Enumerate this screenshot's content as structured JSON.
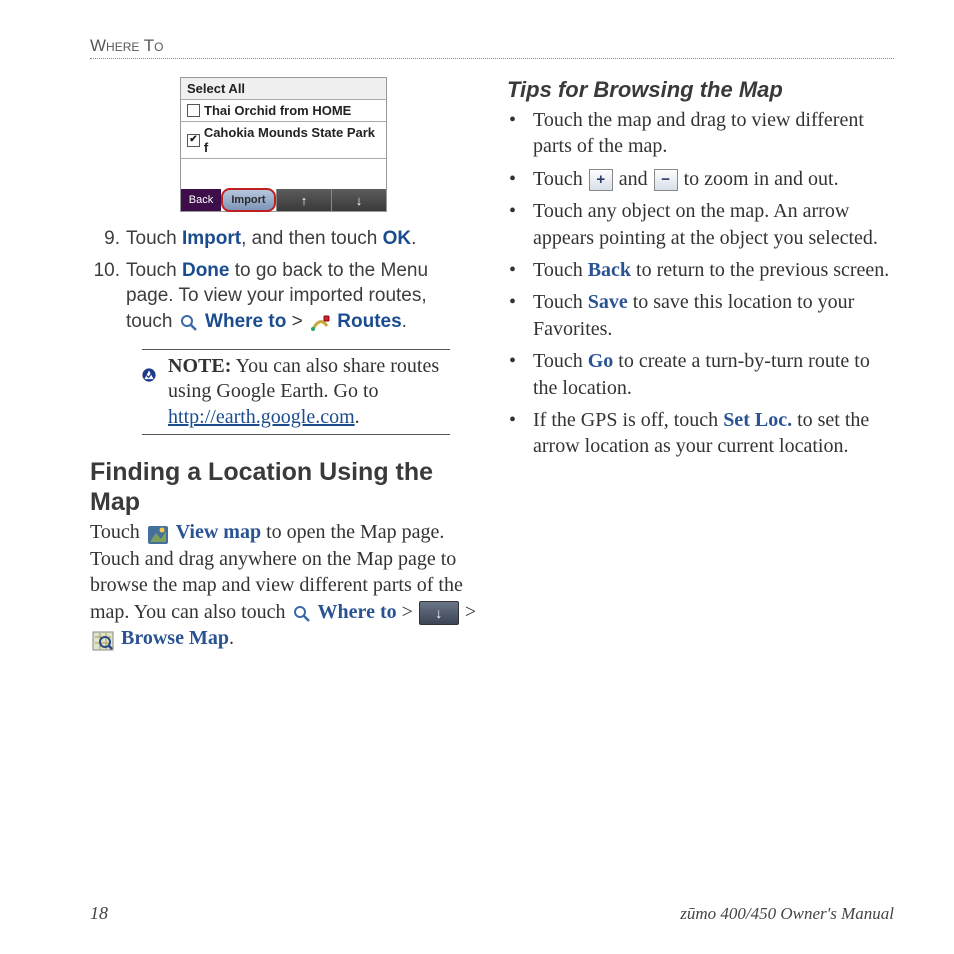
{
  "header": "Where To",
  "screenshot": {
    "select_all": "Select All",
    "row1": "Thai Orchid from HOME",
    "row2": "Cahokia Mounds State Park f",
    "back": "Back",
    "import": "Import"
  },
  "steps": {
    "s9_num": "9.",
    "s9_a": "Touch ",
    "s9_b": "Import",
    "s9_c": ", and then touch ",
    "s9_d": "OK",
    "s9_e": ".",
    "s10_num": "10.",
    "s10_a": "Touch ",
    "s10_b": "Done",
    "s10_c": " to go back to the Menu page. To view your imported routes, touch ",
    "s10_d": "Where to",
    "s10_e": " > ",
    "s10_f": "Routes",
    "s10_g": "."
  },
  "note": {
    "label": "NOTE:",
    "text": " You can also share routes using Google Earth. Go to ",
    "link": "http://earth.google.com",
    "dot": "."
  },
  "section": "Finding a Location Using the Map",
  "finding": {
    "a": "Touch ",
    "b": "View map",
    "c": " to open the Map page. Touch and drag anywhere on the Map page to browse the map and view different parts of the map. You can also touch ",
    "d": "Where to",
    "e": " > ",
    "f": " > ",
    "g": "Browse Map",
    "h": "."
  },
  "subsection": "Tips for Browsing the Map",
  "tips": {
    "t1": "Touch the map and drag to view different parts of the map.",
    "t2a": "Touch ",
    "t2b": " and ",
    "t2c": " to zoom in and out.",
    "t3": "Touch any object on the map. An arrow appears pointing at the object you selected.",
    "t4a": "Touch ",
    "t4b": "Back",
    "t4c": " to return to the previous screen.",
    "t5a": "Touch ",
    "t5b": "Save",
    "t5c": " to save this location to your Favorites.",
    "t6a": "Touch ",
    "t6b": "Go",
    "t6c": " to create a turn-by-turn route to the location.",
    "t7a": "If the GPS is off, touch ",
    "t7b": "Set Loc.",
    "t7c": " to set the arrow location as your current location."
  },
  "footer": {
    "page": "18",
    "title": "zūmo 400/450 Owner's Manual"
  },
  "icons": {
    "plus": "+",
    "minus": "−",
    "down": "↓",
    "up": "↑"
  }
}
